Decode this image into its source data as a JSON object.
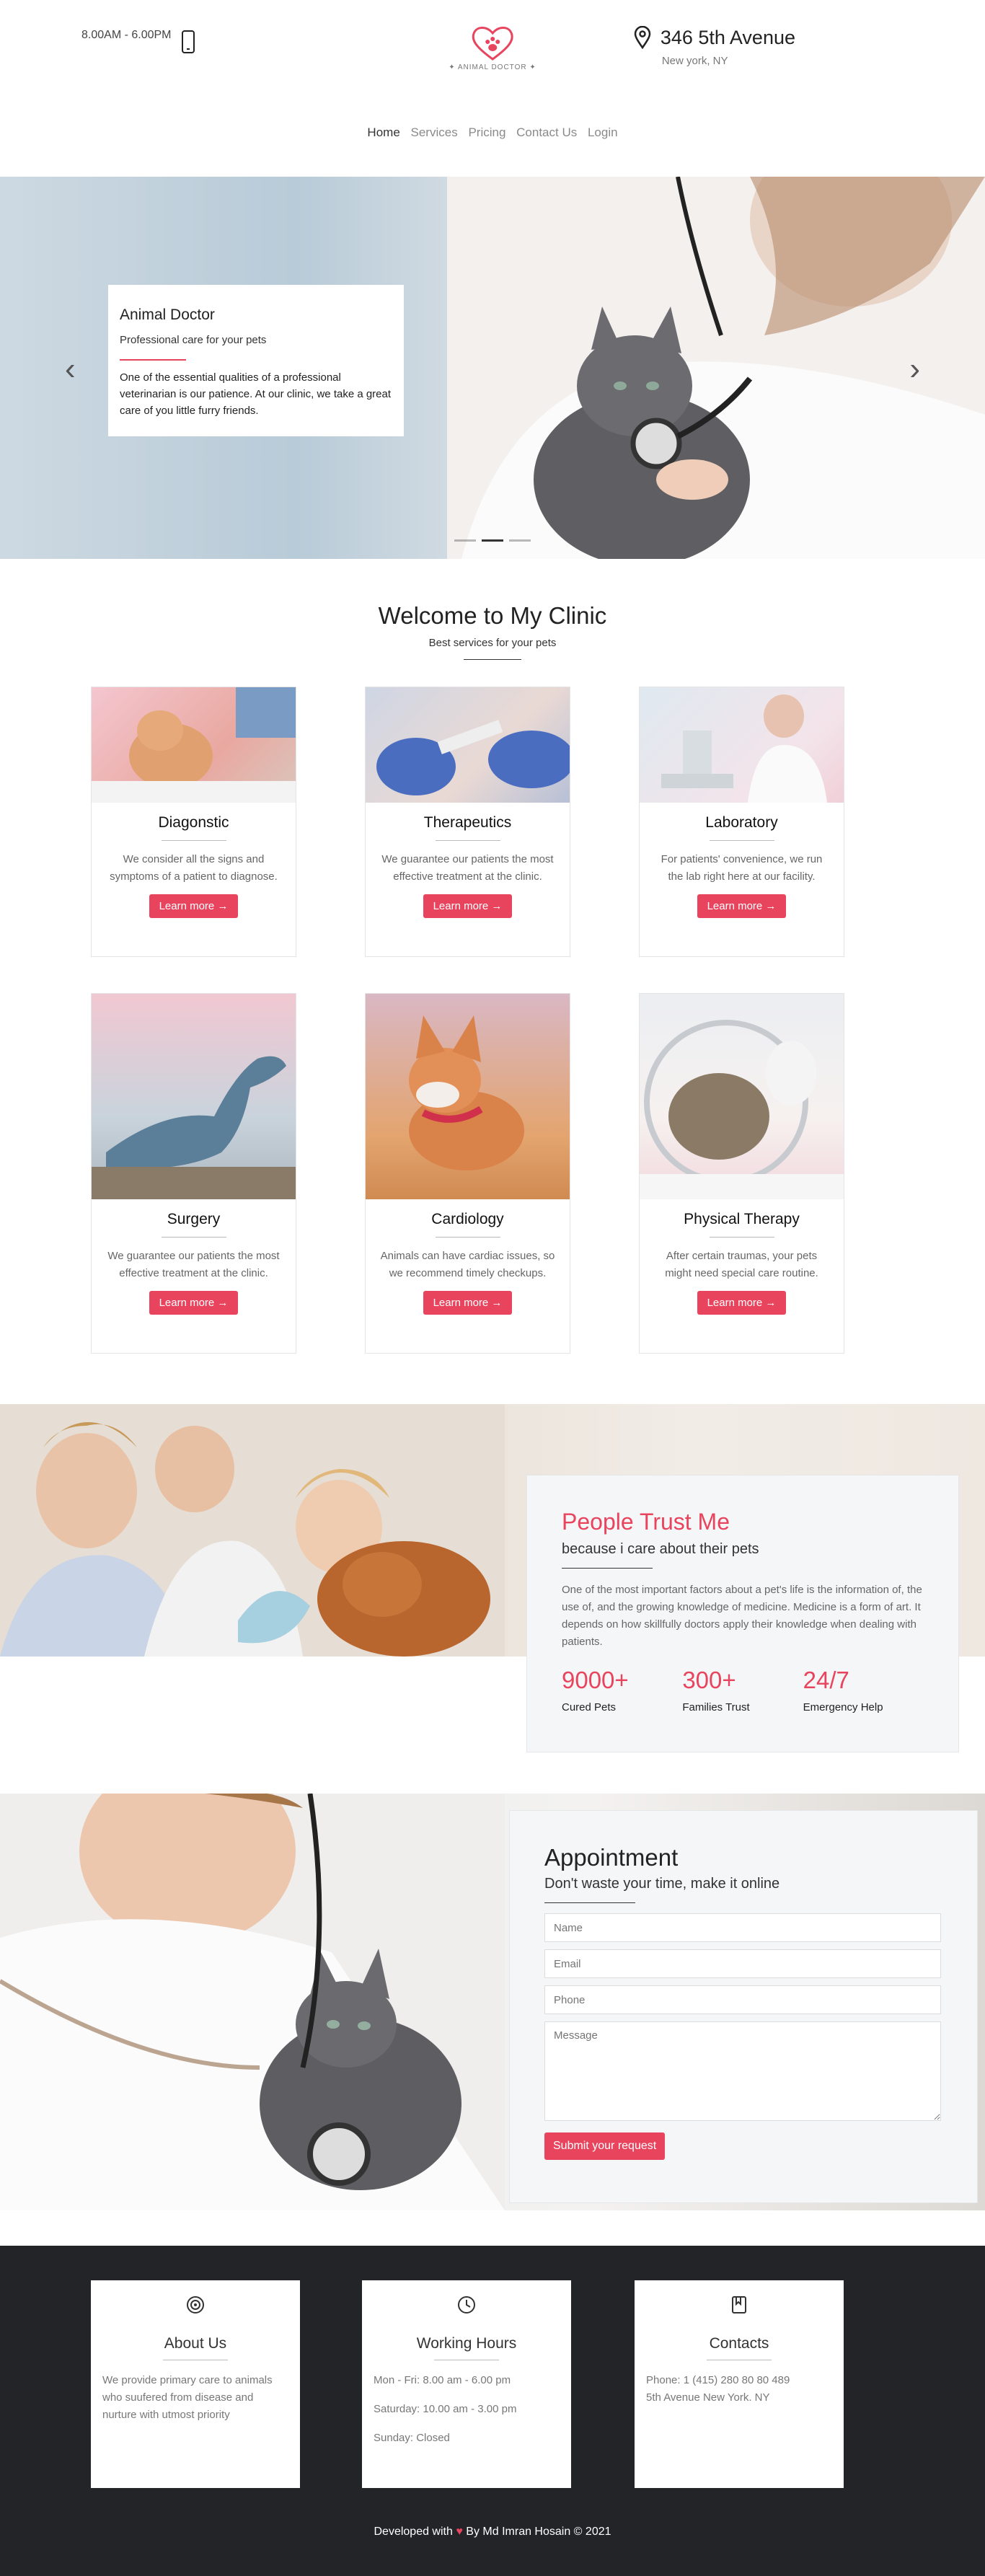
{
  "header": {
    "hours": "8.00AM - 6.00PM",
    "brand_text": "ANIMAL DOCTOR",
    "address_title": "346 5th Avenue",
    "address_sub": "New york, NY"
  },
  "nav": [
    {
      "label": "Home"
    },
    {
      "label": "Services"
    },
    {
      "label": "Pricing"
    },
    {
      "label": "Contact Us"
    },
    {
      "label": "Login"
    }
  ],
  "hero": {
    "title": "Animal Doctor",
    "subtitle": "Professional care for your pets",
    "text": "One of the essential qualities of a professional veterinarian is our patience. At our clinic, we take a great care of you little furry friends.",
    "prev_icon": "chevron-left-icon",
    "next_icon": "chevron-right-icon"
  },
  "welcome": {
    "title": "Welcome to My Clinic",
    "subtitle": "Best services for your pets"
  },
  "services": [
    {
      "title": "Diagonstic",
      "text": "We consider all the signs and symptoms of a patient to diagnose.",
      "button": "Learn more →"
    },
    {
      "title": "Therapeutics",
      "text": "We guarantee our patients the most effective treatment at the clinic.",
      "button": "Learn more →"
    },
    {
      "title": "Laboratory",
      "text": "For patients' convenience, we run the lab right here at our facility.",
      "button": "Learn more →"
    },
    {
      "title": "Surgery",
      "text": "We guarantee our patients the most effective treatment at the clinic.",
      "button": "Learn more →"
    },
    {
      "title": "Cardiology",
      "text": "Animals can have cardiac issues, so we recommend timely checkups.",
      "button": "Learn more →"
    },
    {
      "title": "Physical Therapy",
      "text": "After certain traumas, your pets might need special care routine.",
      "button": "Learn more →"
    }
  ],
  "trust": {
    "title": "People Trust Me",
    "subtitle": "because i care about their pets",
    "text": "One of the most important factors about a pet's life is the information of, the use of, and the growing knowledge of medicine. Medicine is a form of art. It depends on how skillfully doctors apply their knowledge when dealing with patients.",
    "stats": [
      {
        "num": "9000+",
        "label": "Cured Pets"
      },
      {
        "num": "300+",
        "label": "Families Trust"
      },
      {
        "num": "24/7",
        "label": "Emergency Help"
      }
    ]
  },
  "appointment": {
    "title": "Appointment",
    "subtitle": "Don't waste your time, make it online",
    "name_placeholder": "Name",
    "email_placeholder": "Email",
    "phone_placeholder": "Phone",
    "message_placeholder": "Message",
    "submit": "Submit your request"
  },
  "footer": {
    "about": {
      "title": "About Us",
      "text": "We provide primary care to animals who suufered from disease and nurture with utmost priority"
    },
    "hours": {
      "title": "Working Hours",
      "line1": "Mon - Fri: 8.00 am - 6.00 pm",
      "line2": "Saturday: 10.00 am - 3.00 pm",
      "line3": "Sunday: Closed"
    },
    "contacts": {
      "title": "Contacts",
      "line1": "Phone: 1 (415) 280 80 80 489",
      "line2": "5th Avenue New York. NY"
    },
    "copy_prefix": "Developed with",
    "copy_suffix": "By Md Imran Hosain © 2021"
  },
  "colors": {
    "accent": "#e8445e",
    "footer_bg": "#222428"
  }
}
